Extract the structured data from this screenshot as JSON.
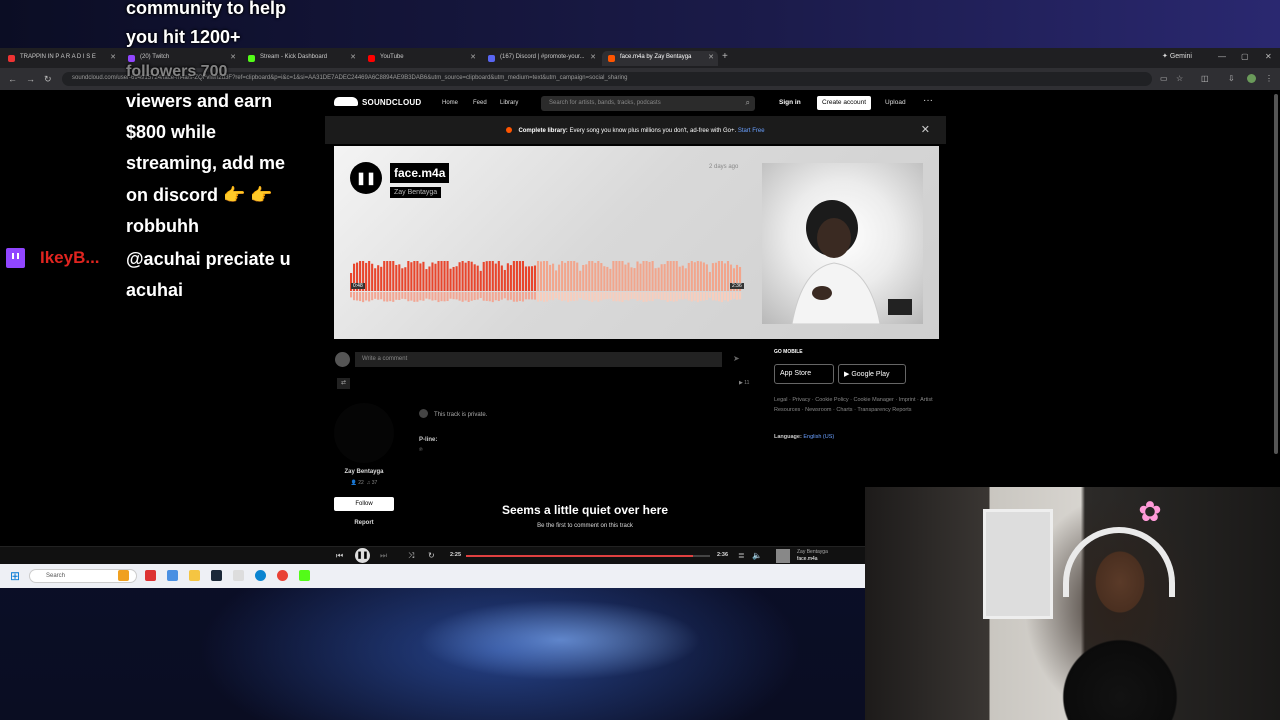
{
  "browser": {
    "tabs": [
      {
        "label": "TRAPPIN IN P A R A D I S E",
        "color": "#e33"
      },
      {
        "label": "(20) Twitch",
        "color": "#9146ff"
      },
      {
        "label": "Stream - Kick Dashboard",
        "color": "#53fc18"
      },
      {
        "label": "YouTube",
        "color": "#f00"
      },
      {
        "label": "(167) Discord | #promote-your...",
        "color": "#5865f2"
      },
      {
        "label": "face.m4a by Zay Bentayga",
        "color": "#ff5500"
      }
    ],
    "gemini_label": "Gemini",
    "url": "soundcloud.com/user-694915724/face-m4a/s-ZQFvlwn2d3F?ref=clipboard&p=i&c=1&si=AA31DE7ADEC24469A6C8894AE9B3DAB6&utm_source=clipboard&utm_medium=text&utm_campaign=social_sharing"
  },
  "soundcloud": {
    "logo": "SOUNDCLOUD",
    "nav": [
      "Home",
      "Feed",
      "Library"
    ],
    "search_placeholder": "Search for artists, bands, tracks, podcasts",
    "signin": "Sign in",
    "create_account": "Create account",
    "upload": "Upload",
    "banner": {
      "bold": "Complete library:",
      "text": " Every song you know plus millions you don't, ad-free with Go+.",
      "link": "Start Free"
    },
    "track": {
      "title": "face.m4a",
      "artist": "Zay Bentayga",
      "posted": "2 days ago",
      "elapsed_label": "0:48",
      "duration_label": "2:36",
      "progress": 0.47
    },
    "comment_placeholder": "Write a comment",
    "plays": "11",
    "user": {
      "name": "Zay Bentayga",
      "followers": "22",
      "tracks": "37"
    },
    "follow": "Follow",
    "report": "Report",
    "private_notice": "This track is private.",
    "pline_label": "P-line:",
    "pline_value": "℗",
    "empty_title": "Seems a little quiet over here",
    "empty_sub": "Be the first to comment on this track",
    "go_mobile": "GO MOBILE",
    "app_store": "App Store",
    "google_play": "Google Play",
    "app_store_pre": "Download on the",
    "google_play_pre": "GET IT ON",
    "footer": "Legal · Privacy · Cookie Policy · Cookie Manager · Imprint · Artist Resources · Newsroom · Charts · Transparency Reports",
    "language_label": "Language:",
    "language_value": "English (US)"
  },
  "player": {
    "elapsed": "2:25",
    "duration": "2:36",
    "progress": 0.93,
    "artist": "Zay Bentayga",
    "track": "face.m4a"
  },
  "taskbar": {
    "search": "Search"
  },
  "overlay": {
    "chat_lines": [
      "community to help",
      "you hit 1200+",
      "followers 700",
      "viewers and earn",
      "$800 while",
      "streaming, add me",
      "on discord 👉 👉",
      "robbuhh",
      "@acuhai preciate u",
      "acuhai"
    ],
    "chat_user": "IkeyB..."
  }
}
